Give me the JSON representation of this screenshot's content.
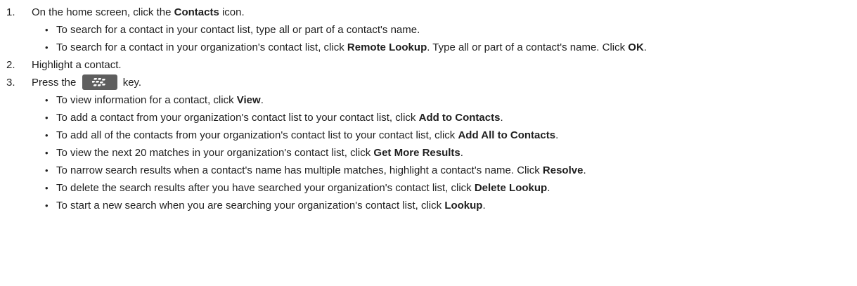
{
  "steps": [
    {
      "num": "1.",
      "parts": [
        {
          "t": "On the home screen, click the ",
          "b": false
        },
        {
          "t": "Contacts",
          "b": true
        },
        {
          "t": " icon.",
          "b": false
        }
      ],
      "bullets": [
        {
          "parts": [
            {
              "t": "To search for a contact in your contact list, type all or part of a contact's name.",
              "b": false
            }
          ]
        },
        {
          "wrap": true,
          "parts": [
            {
              "t": "To search for a contact in your organization's contact list, click ",
              "b": false
            },
            {
              "t": "Remote Lookup",
              "b": true
            },
            {
              "t": ". Type all or part of a contact's name. Click ",
              "b": false
            },
            {
              "t": "OK",
              "b": true
            },
            {
              "t": ".",
              "b": false
            }
          ]
        }
      ]
    },
    {
      "num": "2.",
      "parts": [
        {
          "t": "Highlight a contact.",
          "b": false
        }
      ],
      "bullets": []
    },
    {
      "num": "3.",
      "parts": [
        {
          "t": "Press the ",
          "b": false
        },
        {
          "key": "menu-key-icon"
        },
        {
          "t": " key.",
          "b": false
        }
      ],
      "bullets": [
        {
          "parts": [
            {
              "t": "To view information for a contact, click ",
              "b": false
            },
            {
              "t": "View",
              "b": true
            },
            {
              "t": ".",
              "b": false
            }
          ]
        },
        {
          "parts": [
            {
              "t": "To add a contact from your organization's contact list to your contact list, click ",
              "b": false
            },
            {
              "t": "Add to Contacts",
              "b": true
            },
            {
              "t": ".",
              "b": false
            }
          ]
        },
        {
          "parts": [
            {
              "t": "To add all of the contacts from your organization's contact list to your contact list, click ",
              "b": false
            },
            {
              "t": "Add All to Contacts",
              "b": true
            },
            {
              "t": ".",
              "b": false
            }
          ]
        },
        {
          "parts": [
            {
              "t": "To view the next 20 matches in your organization's contact list, click ",
              "b": false
            },
            {
              "t": "Get More Results",
              "b": true
            },
            {
              "t": ".",
              "b": false
            }
          ]
        },
        {
          "parts": [
            {
              "t": "To narrow search results when a contact's name has multiple matches, highlight a contact's name. Click ",
              "b": false
            },
            {
              "t": "Resolve",
              "b": true
            },
            {
              "t": ".",
              "b": false
            }
          ]
        },
        {
          "parts": [
            {
              "t": "To delete the search results after you have searched your organization's contact list, click ",
              "b": false
            },
            {
              "t": "Delete Lookup",
              "b": true
            },
            {
              "t": ".",
              "b": false
            }
          ]
        },
        {
          "parts": [
            {
              "t": "To start a new search when you are searching your organization's contact list, click ",
              "b": false
            },
            {
              "t": "Lookup",
              "b": true
            },
            {
              "t": ".",
              "b": false
            }
          ]
        }
      ]
    }
  ],
  "bullet_glyph": "•",
  "colors": {
    "text": "#1f1f1f",
    "key_background": "#5e5e5e",
    "key_glyph": "#ffffff"
  }
}
